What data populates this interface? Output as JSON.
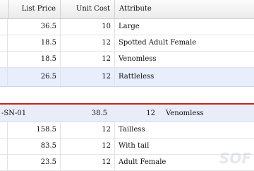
{
  "columns": {
    "first": "",
    "list_price": "List Price",
    "unit_cost": "Unit Cost",
    "attribute": "Attribute"
  },
  "rows_top": [
    {
      "list_price": "36.5",
      "unit_cost": "10",
      "attribute": "Large"
    },
    {
      "list_price": "18.5",
      "unit_cost": "12",
      "attribute": "Spotted Adult Female"
    },
    {
      "list_price": "18.5",
      "unit_cost": "12",
      "attribute": "Venomless"
    },
    {
      "list_price": "26.5",
      "unit_cost": "12",
      "attribute": "Rattleless"
    }
  ],
  "group_row": {
    "id": "-SN-01",
    "list_price": "38.5",
    "unit_cost": "12",
    "attribute": "Venomless"
  },
  "rows_bottom": [
    {
      "list_price": "158.5",
      "unit_cost": "12",
      "attribute": "Tailless"
    },
    {
      "list_price": "83.5",
      "unit_cost": "12",
      "attribute": "With tail"
    },
    {
      "list_price": "23.5",
      "unit_cost": "12",
      "attribute": "Adult Female"
    }
  ],
  "watermark": "SOF",
  "colors": {
    "selected_row": "#e8eefc",
    "divider": "#c22020"
  }
}
